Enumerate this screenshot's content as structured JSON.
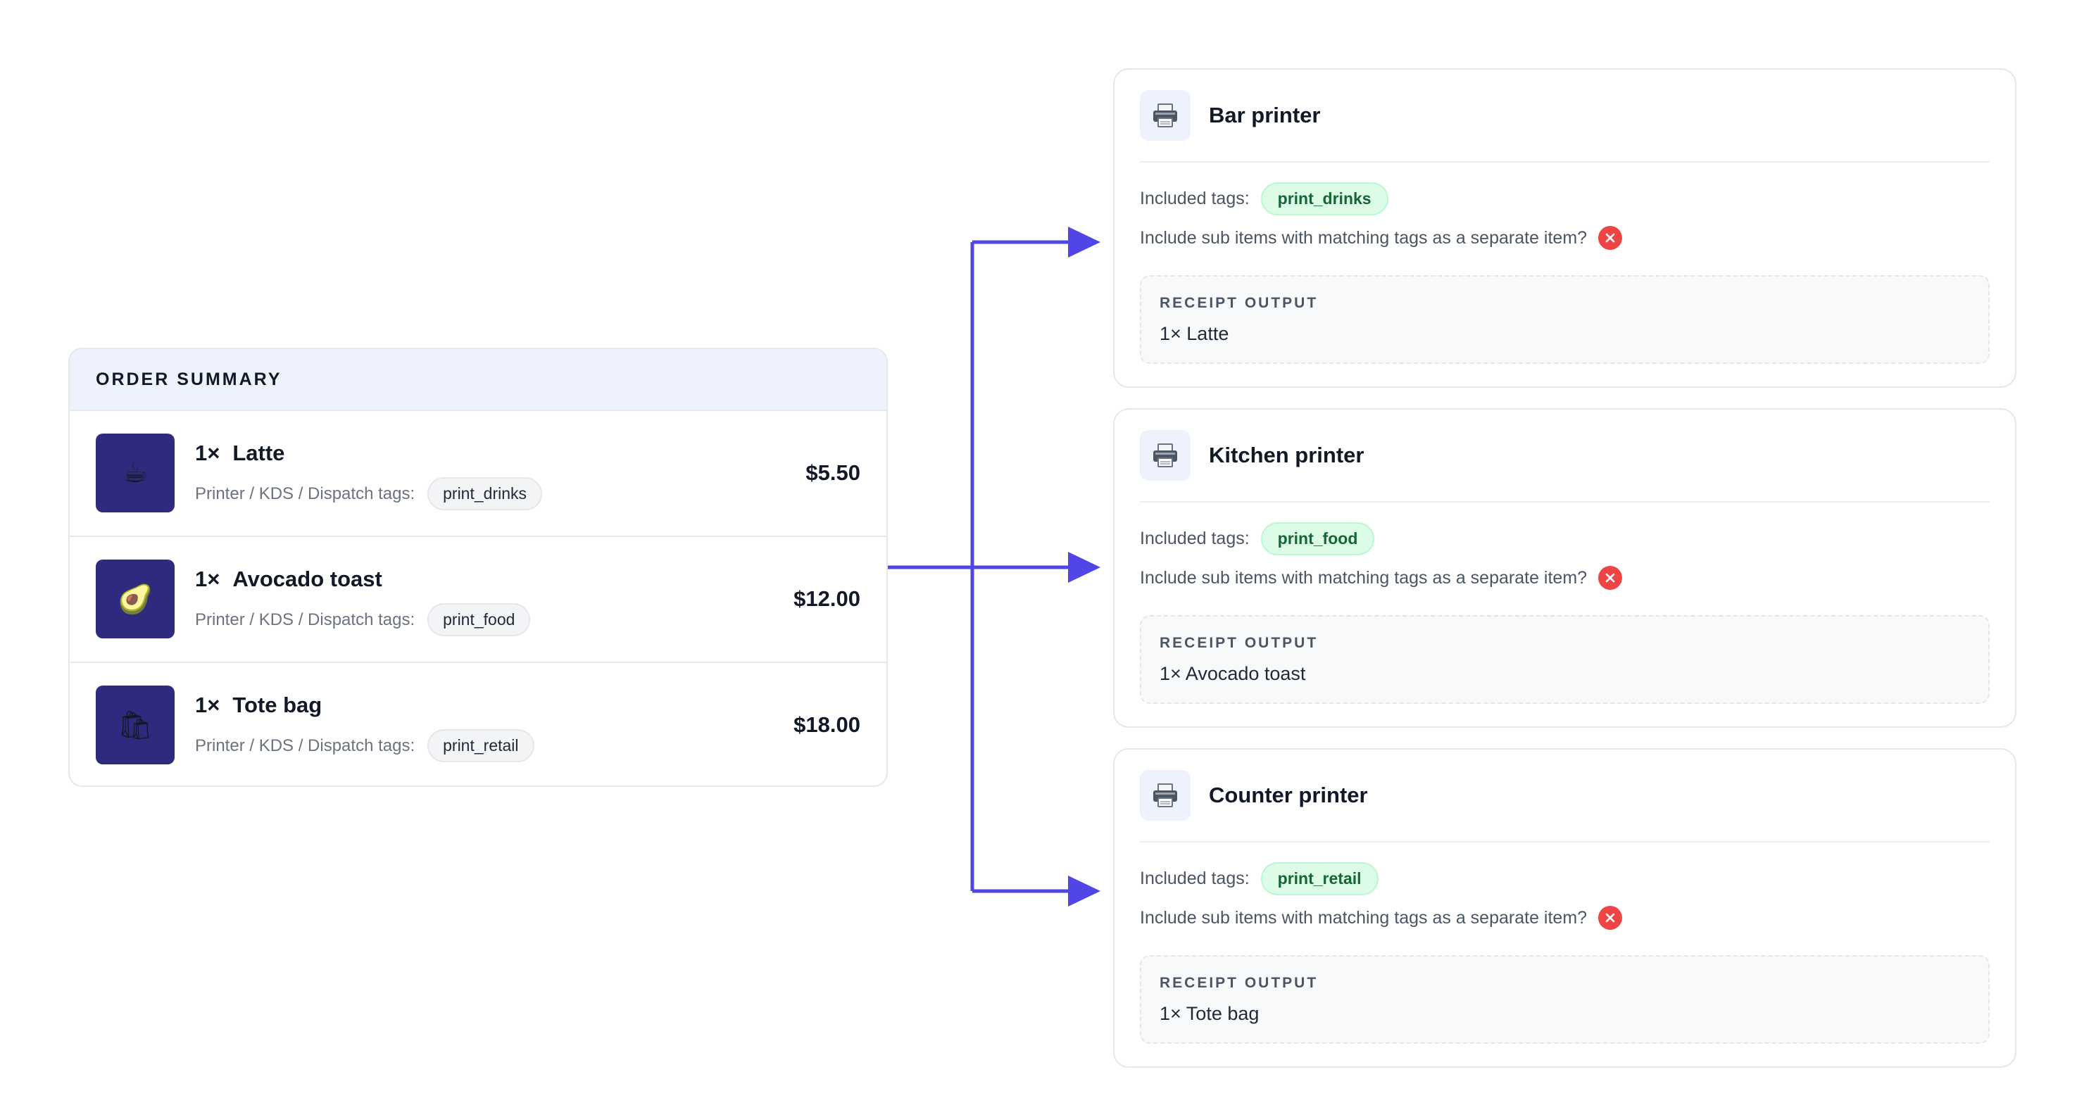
{
  "order_summary": {
    "title": "ORDER SUMMARY",
    "tags_label": "Printer / KDS / Dispatch tags:",
    "items": [
      {
        "qty": "1×",
        "name": "Latte",
        "icon": "coffee-icon",
        "glyph": "☕",
        "tag": "print_drinks",
        "price": "$5.50"
      },
      {
        "qty": "1×",
        "name": "Avocado toast",
        "icon": "avocado-icon",
        "glyph": "🥑",
        "tag": "print_food",
        "price": "$12.00"
      },
      {
        "qty": "1×",
        "name": "Tote bag",
        "icon": "shopping-bags-icon",
        "glyph": "🛍",
        "tag": "print_retail",
        "price": "$18.00"
      }
    ]
  },
  "printers": [
    {
      "name": "Bar printer",
      "included_label": "Included tags:",
      "included_tag": "print_drinks",
      "sub_items_question": "Include sub items with matching tags as a separate item?",
      "receipt_label": "RECEIPT OUTPUT",
      "receipt_line": "1× Latte"
    },
    {
      "name": "Kitchen printer",
      "included_label": "Included tags:",
      "included_tag": "print_food",
      "sub_items_question": "Include sub items with matching tags as a separate item?",
      "receipt_label": "RECEIPT OUTPUT",
      "receipt_line": "1× Avocado toast"
    },
    {
      "name": "Counter printer",
      "included_label": "Included tags:",
      "included_tag": "print_retail",
      "sub_items_question": "Include sub items with matching tags as a separate item?",
      "receipt_label": "RECEIPT OUTPUT",
      "receipt_line": "1× Tote bag"
    }
  ],
  "colors": {
    "accent": "#4f46e5",
    "thumb_bg": "#2e2a7e",
    "tag_green_bg": "#dcfce7",
    "tag_green_text": "#166534",
    "error": "#ef4444",
    "header_bg": "#eef2fc"
  }
}
